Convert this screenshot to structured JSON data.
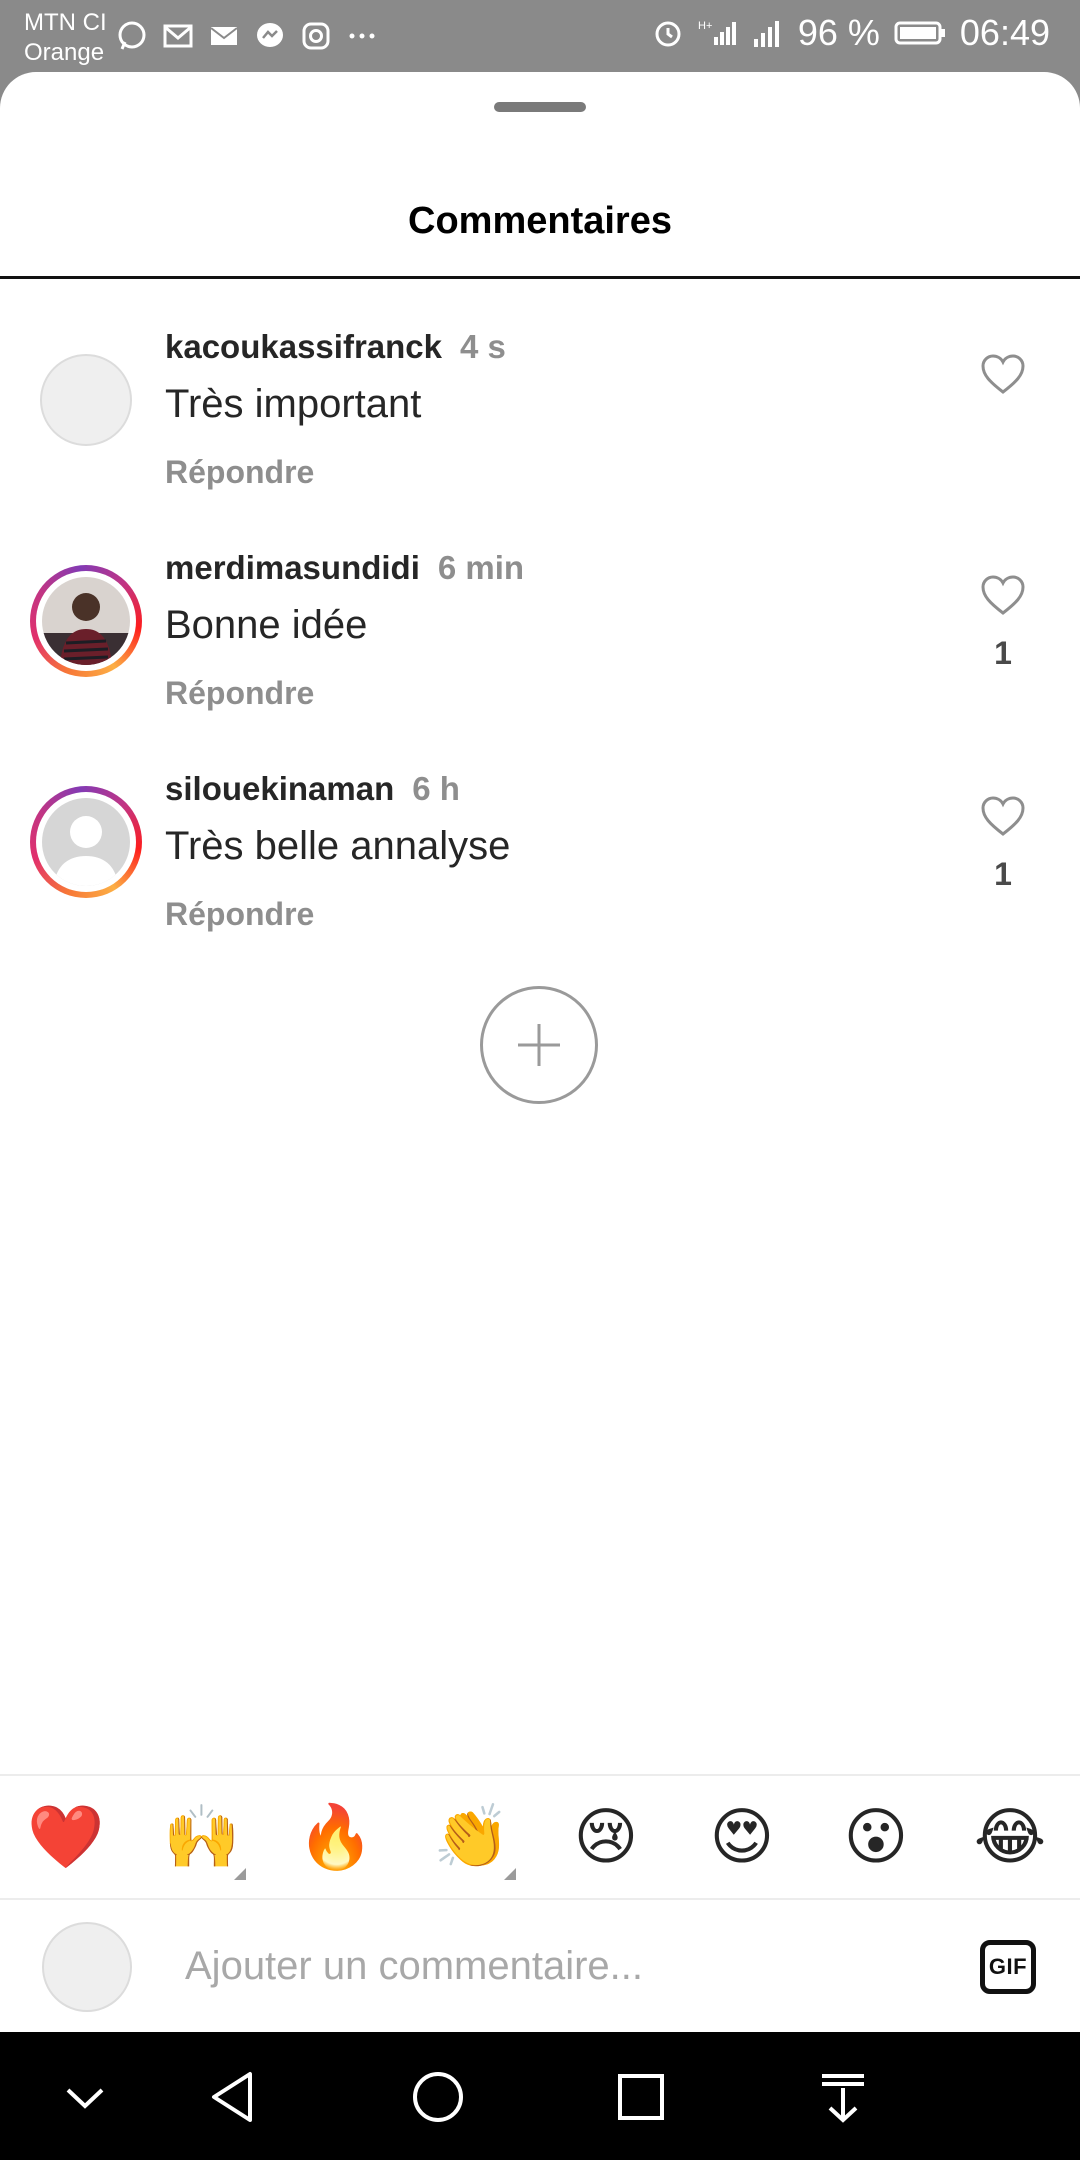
{
  "status_bar": {
    "carrier_line1": "MTN CI",
    "carrier_line2": "Orange",
    "battery_pct": "96 %",
    "time": "06:49",
    "icons": [
      "whatsapp-icon",
      "gmail-icon",
      "mail-icon",
      "messenger-icon",
      "instagram-icon",
      "more-icon",
      "alarm-icon",
      "data-icon",
      "signal-icon",
      "battery-icon"
    ]
  },
  "sheet": {
    "title": "Commentaires"
  },
  "comments": [
    {
      "username": "kacoukassifranck",
      "time": "4 s",
      "text": "Très important",
      "reply_label": "Répondre",
      "likes": ""
    },
    {
      "username": "merdimasundidi",
      "time": "6 min",
      "text": "Bonne idée",
      "reply_label": "Répondre",
      "likes": "1"
    },
    {
      "username": "silouekinaman",
      "time": "6 h",
      "text": "Très belle annalyse",
      "reply_label": "Répondre",
      "likes": "1"
    }
  ],
  "emoji_bar": [
    "❤️",
    "🙌",
    "🔥",
    "👏",
    "😢",
    "😍",
    "😮",
    "😂"
  ],
  "composer": {
    "placeholder": "Ajouter un commentaire...",
    "gif_label": "GIF"
  },
  "nav_bar": {
    "icons": [
      "chevron-down-icon",
      "back-icon",
      "home-icon",
      "recents-icon",
      "notification-pull-icon"
    ]
  },
  "colors": {
    "status_bar": "#8a8a8a",
    "text": "#262626",
    "secondary_text": "#8e8e8e",
    "nav_bar": "#000000"
  }
}
